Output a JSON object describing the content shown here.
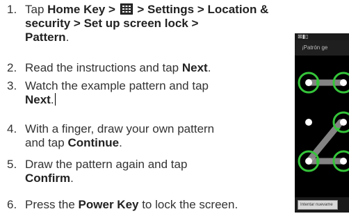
{
  "steps": [
    {
      "number": "1.",
      "line1_a": "Tap ",
      "line1_b": "Home Key >",
      "line1_icon": "app-grid-icon",
      "line1_c": "> Settings > Location &",
      "line2": "security > Set up screen lock >",
      "line3": "Pattern",
      "line3_end": "."
    },
    {
      "number": "2.",
      "text_a": "Read the instructions and tap ",
      "bold": "Next",
      "text_b": "."
    },
    {
      "number": "3.",
      "line1": "Watch the example pattern and tap",
      "bold": "Next",
      "text_b": "."
    },
    {
      "number": "4.",
      "line1": "With a finger, draw your own pattern",
      "text_a": "and tap ",
      "bold": "Continue",
      "text_b": "."
    },
    {
      "number": "5.",
      "line1": "Draw the pattern again and tap",
      "bold": "Confirm",
      "text_b": "."
    },
    {
      "number": "6.",
      "text_a": "Press the ",
      "bold": "Power Key",
      "text_b": " to lock the screen."
    }
  ],
  "phone": {
    "status_icons": "⊠▮▯",
    "title": "¡Patrón ge",
    "retry_button": "Intentar nuevame",
    "pattern_color": "#35c43a",
    "line_color": "#9a9a9a"
  },
  "colors": {
    "text": "#333333",
    "bold": "#222222"
  }
}
